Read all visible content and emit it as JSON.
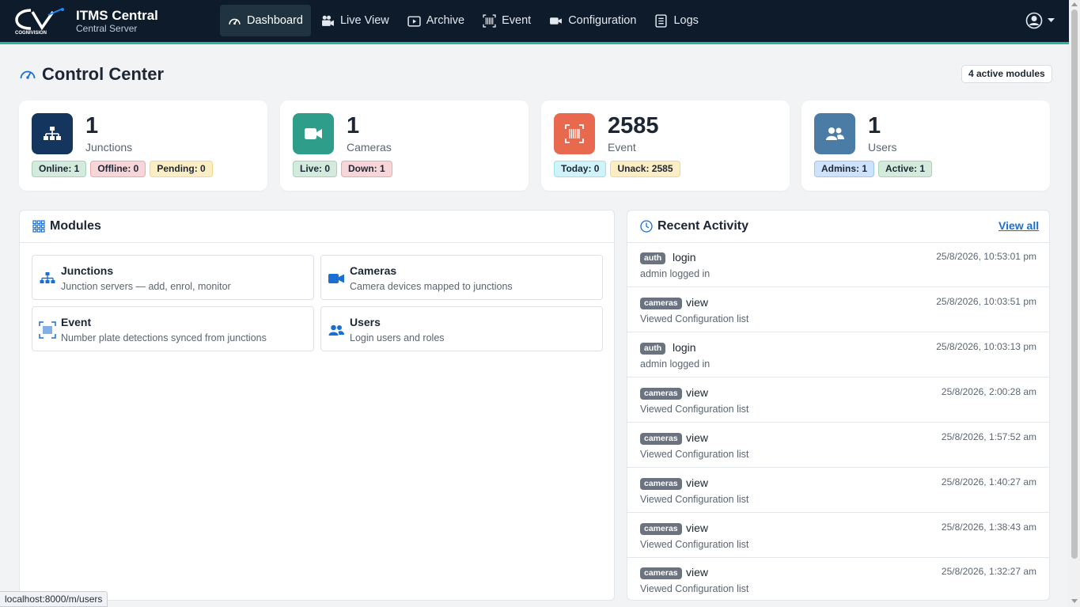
{
  "brand": {
    "logo_text": "COGNIVISION",
    "title": "ITMS Central",
    "subtitle": "Central Server"
  },
  "nav": {
    "items": [
      {
        "label": "Dashboard",
        "icon": "gauge-icon",
        "active": true
      },
      {
        "label": "Live View",
        "icon": "video-camera-icon",
        "active": false
      },
      {
        "label": "Archive",
        "icon": "play-archive-icon",
        "active": false
      },
      {
        "label": "Event",
        "icon": "barcode-scan-icon",
        "active": false
      },
      {
        "label": "Configuration",
        "icon": "camera-icon",
        "active": false
      },
      {
        "label": "Logs",
        "icon": "list-log-icon",
        "active": false
      }
    ],
    "user_icon": "user-avatar-icon"
  },
  "header": {
    "title": "Control Center",
    "badge": "4 active modules"
  },
  "stats": [
    {
      "value": "1",
      "label": "Junctions",
      "icon": "sitemap-icon",
      "color": "#13355e",
      "pills": [
        {
          "text": "Online: 1",
          "tone": "green"
        },
        {
          "text": "Offline: 0",
          "tone": "red"
        },
        {
          "text": "Pending: 0",
          "tone": "yellow"
        }
      ]
    },
    {
      "value": "1",
      "label": "Cameras",
      "icon": "video-icon",
      "color": "#2e9d8a",
      "pills": [
        {
          "text": "Live: 0",
          "tone": "green"
        },
        {
          "text": "Down: 1",
          "tone": "red"
        }
      ]
    },
    {
      "value": "2585",
      "label": "Event",
      "icon": "barcode-scan-icon",
      "color": "#e8694e",
      "pills": [
        {
          "text": "Today: 0",
          "tone": "cyan"
        },
        {
          "text": "Unack: 2585",
          "tone": "yellow"
        }
      ]
    },
    {
      "value": "1",
      "label": "Users",
      "icon": "users-icon",
      "color": "#4a7ca5",
      "pills": [
        {
          "text": "Admins: 1",
          "tone": "blue"
        },
        {
          "text": "Active: 1",
          "tone": "green"
        }
      ]
    }
  ],
  "modules": {
    "title": "Modules",
    "items": [
      {
        "title": "Junctions",
        "desc": "Junction servers — add, enrol, monitor",
        "icon": "sitemap-icon"
      },
      {
        "title": "Cameras",
        "desc": "Camera devices mapped to junctions",
        "icon": "video-icon"
      },
      {
        "title": "Event",
        "desc": "Number plate detections synced from junctions",
        "icon": "barcode-scan-icon"
      },
      {
        "title": "Users",
        "desc": "Login users and roles",
        "icon": "users-icon"
      }
    ]
  },
  "activity": {
    "title": "Recent Activity",
    "view_all": "View all",
    "items": [
      {
        "tag": "auth",
        "action": "login",
        "desc": "admin logged in",
        "time": "25/8/2026, 10:53:01 pm"
      },
      {
        "tag": "cameras",
        "action": "view",
        "desc": "Viewed Configuration list",
        "time": "25/8/2026, 10:03:51 pm"
      },
      {
        "tag": "auth",
        "action": "login",
        "desc": "admin logged in",
        "time": "25/8/2026, 10:03:13 pm"
      },
      {
        "tag": "cameras",
        "action": "view",
        "desc": "Viewed Configuration list",
        "time": "25/8/2026, 2:00:28 am"
      },
      {
        "tag": "cameras",
        "action": "view",
        "desc": "Viewed Configuration list",
        "time": "25/8/2026, 1:57:52 am"
      },
      {
        "tag": "cameras",
        "action": "view",
        "desc": "Viewed Configuration list",
        "time": "25/8/2026, 1:40:27 am"
      },
      {
        "tag": "cameras",
        "action": "view",
        "desc": "Viewed Configuration list",
        "time": "25/8/2026, 1:38:43 am"
      },
      {
        "tag": "cameras",
        "action": "view",
        "desc": "Viewed Configuration list",
        "time": "25/8/2026, 1:32:27 am"
      }
    ]
  },
  "status_bar": {
    "url": "localhost:8000/m/users"
  }
}
